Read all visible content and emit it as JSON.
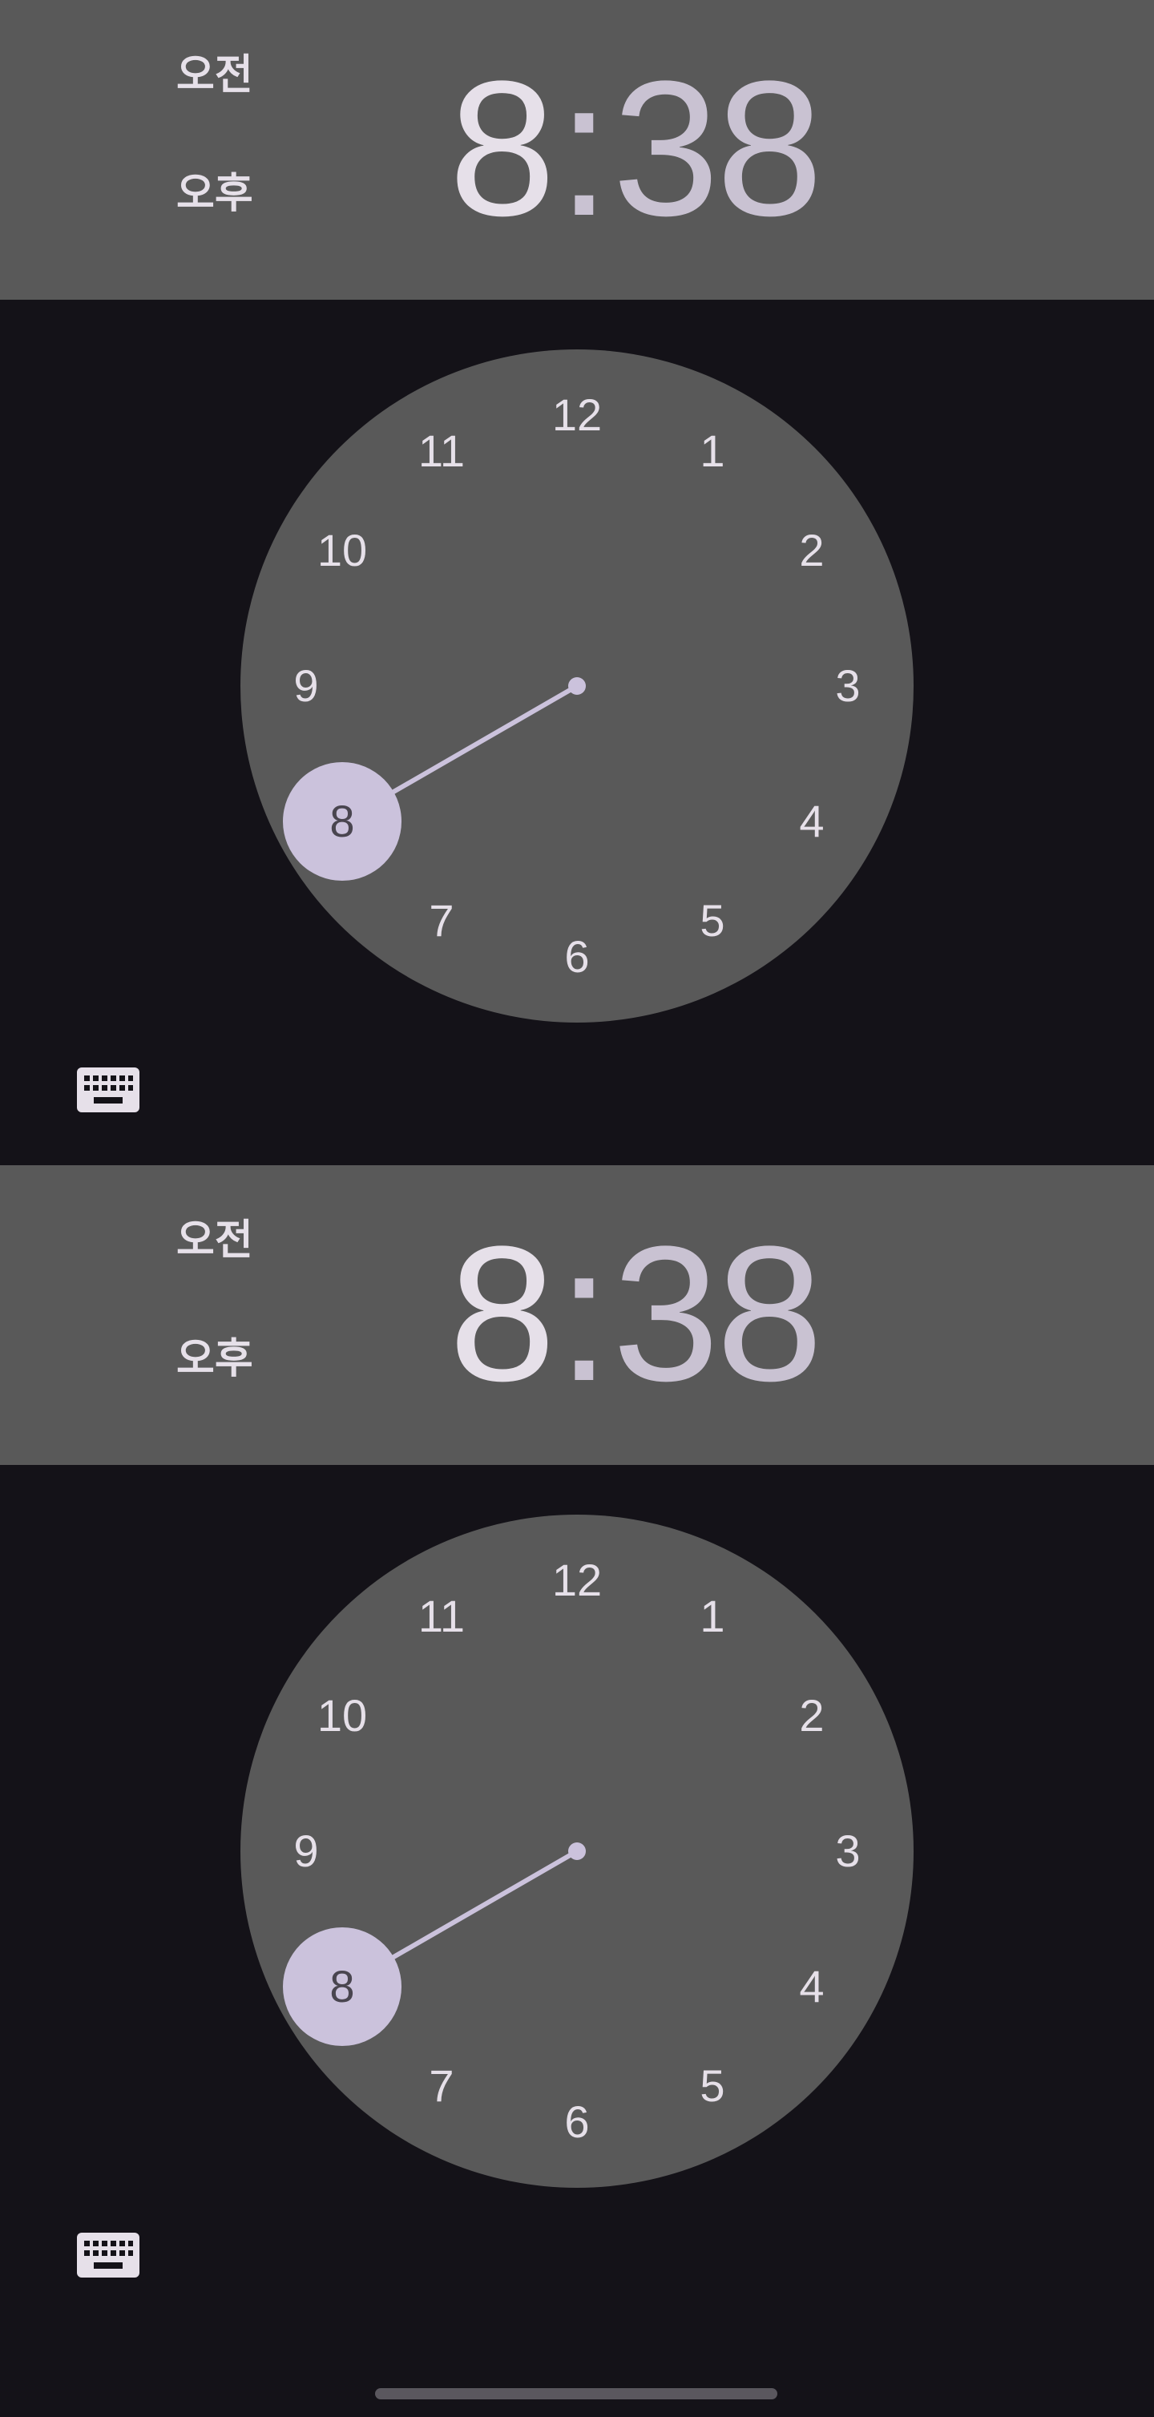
{
  "pickers": [
    {
      "am_label": "오전",
      "pm_label": "오후",
      "hour": "8",
      "separator": ":",
      "minute": "38",
      "selected_hour": 8,
      "dial_numbers": [
        "12",
        "1",
        "2",
        "3",
        "4",
        "5",
        "6",
        "7",
        "8",
        "9",
        "10",
        "11"
      ],
      "input_mode_icon": "keyboard-icon"
    },
    {
      "am_label": "오전",
      "pm_label": "오후",
      "hour": "8",
      "separator": ":",
      "minute": "38",
      "selected_hour": 8,
      "dial_numbers": [
        "12",
        "1",
        "2",
        "3",
        "4",
        "5",
        "6",
        "7",
        "8",
        "9",
        "10",
        "11"
      ],
      "input_mode_icon": "keyboard-icon"
    }
  ],
  "colors": {
    "background": "#141218",
    "header_background": "#595959",
    "dial_background": "#595959",
    "accent": "#cbc2dc",
    "text_primary": "#e6e0e9",
    "text_on_accent": "#49454f"
  }
}
